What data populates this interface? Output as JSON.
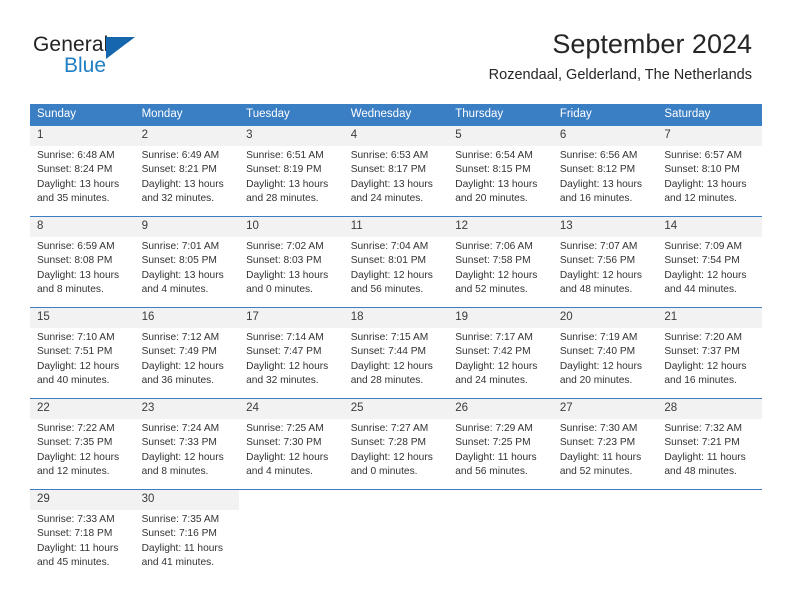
{
  "logo": {
    "word1": "General",
    "word2": "Blue",
    "triangle_color": "#1566ad",
    "blue_color": "#1f7fc4",
    "dark_color": "#232323"
  },
  "header": {
    "title": "September 2024",
    "subtitle": "Rozendaal, Gelderland, The Netherlands"
  },
  "theme": {
    "header_bg": "#3a7ec4",
    "daynum_bg": "#f2f2f2",
    "grid_line": "#3a7ec4",
    "text": "#333333"
  },
  "calendar": {
    "weekdays": [
      "Sunday",
      "Monday",
      "Tuesday",
      "Wednesday",
      "Thursday",
      "Friday",
      "Saturday"
    ],
    "weeks": [
      [
        {
          "day": "1",
          "sunrise": "Sunrise: 6:48 AM",
          "sunset": "Sunset: 8:24 PM",
          "daylight1": "Daylight: 13 hours",
          "daylight2": "and 35 minutes."
        },
        {
          "day": "2",
          "sunrise": "Sunrise: 6:49 AM",
          "sunset": "Sunset: 8:21 PM",
          "daylight1": "Daylight: 13 hours",
          "daylight2": "and 32 minutes."
        },
        {
          "day": "3",
          "sunrise": "Sunrise: 6:51 AM",
          "sunset": "Sunset: 8:19 PM",
          "daylight1": "Daylight: 13 hours",
          "daylight2": "and 28 minutes."
        },
        {
          "day": "4",
          "sunrise": "Sunrise: 6:53 AM",
          "sunset": "Sunset: 8:17 PM",
          "daylight1": "Daylight: 13 hours",
          "daylight2": "and 24 minutes."
        },
        {
          "day": "5",
          "sunrise": "Sunrise: 6:54 AM",
          "sunset": "Sunset: 8:15 PM",
          "daylight1": "Daylight: 13 hours",
          "daylight2": "and 20 minutes."
        },
        {
          "day": "6",
          "sunrise": "Sunrise: 6:56 AM",
          "sunset": "Sunset: 8:12 PM",
          "daylight1": "Daylight: 13 hours",
          "daylight2": "and 16 minutes."
        },
        {
          "day": "7",
          "sunrise": "Sunrise: 6:57 AM",
          "sunset": "Sunset: 8:10 PM",
          "daylight1": "Daylight: 13 hours",
          "daylight2": "and 12 minutes."
        }
      ],
      [
        {
          "day": "8",
          "sunrise": "Sunrise: 6:59 AM",
          "sunset": "Sunset: 8:08 PM",
          "daylight1": "Daylight: 13 hours",
          "daylight2": "and 8 minutes."
        },
        {
          "day": "9",
          "sunrise": "Sunrise: 7:01 AM",
          "sunset": "Sunset: 8:05 PM",
          "daylight1": "Daylight: 13 hours",
          "daylight2": "and 4 minutes."
        },
        {
          "day": "10",
          "sunrise": "Sunrise: 7:02 AM",
          "sunset": "Sunset: 8:03 PM",
          "daylight1": "Daylight: 13 hours",
          "daylight2": "and 0 minutes."
        },
        {
          "day": "11",
          "sunrise": "Sunrise: 7:04 AM",
          "sunset": "Sunset: 8:01 PM",
          "daylight1": "Daylight: 12 hours",
          "daylight2": "and 56 minutes."
        },
        {
          "day": "12",
          "sunrise": "Sunrise: 7:06 AM",
          "sunset": "Sunset: 7:58 PM",
          "daylight1": "Daylight: 12 hours",
          "daylight2": "and 52 minutes."
        },
        {
          "day": "13",
          "sunrise": "Sunrise: 7:07 AM",
          "sunset": "Sunset: 7:56 PM",
          "daylight1": "Daylight: 12 hours",
          "daylight2": "and 48 minutes."
        },
        {
          "day": "14",
          "sunrise": "Sunrise: 7:09 AM",
          "sunset": "Sunset: 7:54 PM",
          "daylight1": "Daylight: 12 hours",
          "daylight2": "and 44 minutes."
        }
      ],
      [
        {
          "day": "15",
          "sunrise": "Sunrise: 7:10 AM",
          "sunset": "Sunset: 7:51 PM",
          "daylight1": "Daylight: 12 hours",
          "daylight2": "and 40 minutes."
        },
        {
          "day": "16",
          "sunrise": "Sunrise: 7:12 AM",
          "sunset": "Sunset: 7:49 PM",
          "daylight1": "Daylight: 12 hours",
          "daylight2": "and 36 minutes."
        },
        {
          "day": "17",
          "sunrise": "Sunrise: 7:14 AM",
          "sunset": "Sunset: 7:47 PM",
          "daylight1": "Daylight: 12 hours",
          "daylight2": "and 32 minutes."
        },
        {
          "day": "18",
          "sunrise": "Sunrise: 7:15 AM",
          "sunset": "Sunset: 7:44 PM",
          "daylight1": "Daylight: 12 hours",
          "daylight2": "and 28 minutes."
        },
        {
          "day": "19",
          "sunrise": "Sunrise: 7:17 AM",
          "sunset": "Sunset: 7:42 PM",
          "daylight1": "Daylight: 12 hours",
          "daylight2": "and 24 minutes."
        },
        {
          "day": "20",
          "sunrise": "Sunrise: 7:19 AM",
          "sunset": "Sunset: 7:40 PM",
          "daylight1": "Daylight: 12 hours",
          "daylight2": "and 20 minutes."
        },
        {
          "day": "21",
          "sunrise": "Sunrise: 7:20 AM",
          "sunset": "Sunset: 7:37 PM",
          "daylight1": "Daylight: 12 hours",
          "daylight2": "and 16 minutes."
        }
      ],
      [
        {
          "day": "22",
          "sunrise": "Sunrise: 7:22 AM",
          "sunset": "Sunset: 7:35 PM",
          "daylight1": "Daylight: 12 hours",
          "daylight2": "and 12 minutes."
        },
        {
          "day": "23",
          "sunrise": "Sunrise: 7:24 AM",
          "sunset": "Sunset: 7:33 PM",
          "daylight1": "Daylight: 12 hours",
          "daylight2": "and 8 minutes."
        },
        {
          "day": "24",
          "sunrise": "Sunrise: 7:25 AM",
          "sunset": "Sunset: 7:30 PM",
          "daylight1": "Daylight: 12 hours",
          "daylight2": "and 4 minutes."
        },
        {
          "day": "25",
          "sunrise": "Sunrise: 7:27 AM",
          "sunset": "Sunset: 7:28 PM",
          "daylight1": "Daylight: 12 hours",
          "daylight2": "and 0 minutes."
        },
        {
          "day": "26",
          "sunrise": "Sunrise: 7:29 AM",
          "sunset": "Sunset: 7:25 PM",
          "daylight1": "Daylight: 11 hours",
          "daylight2": "and 56 minutes."
        },
        {
          "day": "27",
          "sunrise": "Sunrise: 7:30 AM",
          "sunset": "Sunset: 7:23 PM",
          "daylight1": "Daylight: 11 hours",
          "daylight2": "and 52 minutes."
        },
        {
          "day": "28",
          "sunrise": "Sunrise: 7:32 AM",
          "sunset": "Sunset: 7:21 PM",
          "daylight1": "Daylight: 11 hours",
          "daylight2": "and 48 minutes."
        }
      ],
      [
        {
          "day": "29",
          "sunrise": "Sunrise: 7:33 AM",
          "sunset": "Sunset: 7:18 PM",
          "daylight1": "Daylight: 11 hours",
          "daylight2": "and 45 minutes."
        },
        {
          "day": "30",
          "sunrise": "Sunrise: 7:35 AM",
          "sunset": "Sunset: 7:16 PM",
          "daylight1": "Daylight: 11 hours",
          "daylight2": "and 41 minutes."
        },
        {
          "day": "",
          "sunrise": "",
          "sunset": "",
          "daylight1": "",
          "daylight2": ""
        },
        {
          "day": "",
          "sunrise": "",
          "sunset": "",
          "daylight1": "",
          "daylight2": ""
        },
        {
          "day": "",
          "sunrise": "",
          "sunset": "",
          "daylight1": "",
          "daylight2": ""
        },
        {
          "day": "",
          "sunrise": "",
          "sunset": "",
          "daylight1": "",
          "daylight2": ""
        },
        {
          "day": "",
          "sunrise": "",
          "sunset": "",
          "daylight1": "",
          "daylight2": ""
        }
      ]
    ]
  }
}
